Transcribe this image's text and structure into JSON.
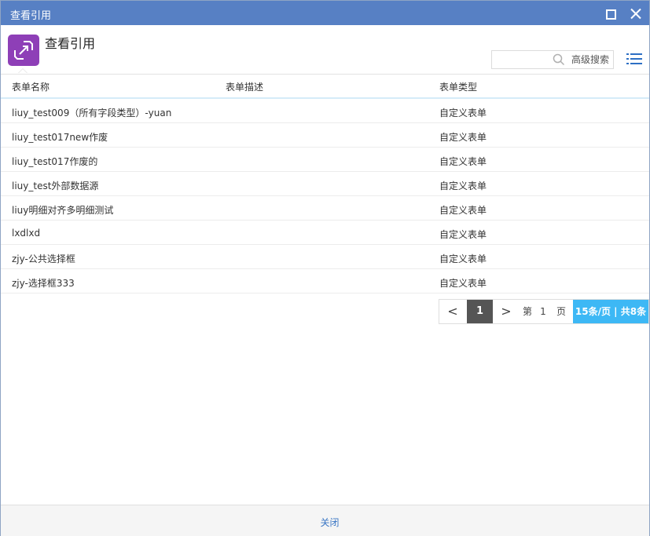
{
  "window": {
    "title": "查看引用"
  },
  "header": {
    "app_icon": "swap-arrows-icon",
    "title": "查看引用",
    "search": {
      "value": "",
      "placeholder": ""
    },
    "advanced_search_label": "高级搜索"
  },
  "table": {
    "columns": [
      "表单名称",
      "表单描述",
      "表单类型"
    ],
    "rows": [
      {
        "name": "liuy_test009（所有字段类型）-yuan",
        "desc": "",
        "type": "自定义表单"
      },
      {
        "name": "liuy_test017new作废",
        "desc": "",
        "type": "自定义表单"
      },
      {
        "name": "liuy_test017作废的",
        "desc": "",
        "type": "自定义表单"
      },
      {
        "name": "liuy_test外部数据源",
        "desc": "",
        "type": "自定义表单"
      },
      {
        "name": "liuy明细对齐多明细测试",
        "desc": "",
        "type": "自定义表单"
      },
      {
        "name": "lxdlxd",
        "desc": "",
        "type": "自定义表单"
      },
      {
        "name": "zjy-公共选择框",
        "desc": "",
        "type": "自定义表单"
      },
      {
        "name": "zjy-选择框333",
        "desc": "",
        "type": "自定义表单"
      }
    ]
  },
  "pager": {
    "prev": "<",
    "current": "1",
    "next": ">",
    "di": "第",
    "page_num": "1",
    "ye": "页",
    "info": "15条/页 | 共8条"
  },
  "footer": {
    "close_label": "关闭"
  },
  "colors": {
    "titlebar": "#5780c4",
    "accent": "#3db8f5",
    "icon_bg": "#8e3fb7"
  }
}
